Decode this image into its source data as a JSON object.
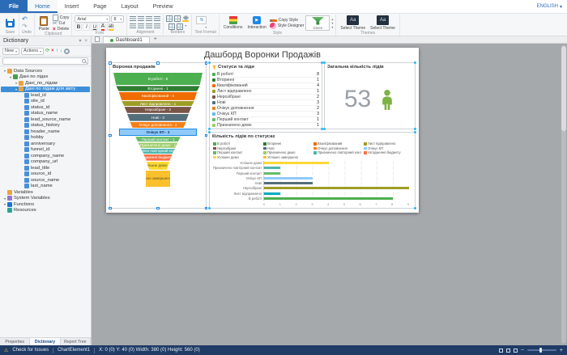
{
  "ribbon": {
    "tabs": [
      "File",
      "Home",
      "Insert",
      "Page",
      "Layout",
      "Preview"
    ],
    "active_tab": "Home",
    "language": "ENGLISH",
    "save": {
      "caption": "Save"
    },
    "undo": {
      "caption": "Undo"
    },
    "clipboard": {
      "caption": "Clipboard",
      "paste": "Paste",
      "copy": "Copy",
      "cut": "Cut",
      "delete": "Delete"
    },
    "font": {
      "caption": "Font",
      "family": "Arial",
      "size": "8",
      "bold": "B",
      "italic": "I",
      "underline": "U"
    },
    "alignment": {
      "caption": "Alignment"
    },
    "borders": {
      "caption": "Borders"
    },
    "text_format": {
      "caption": "Text Format"
    },
    "style": {
      "caption": "Style",
      "conditions": "Conditions",
      "interaction": "Interaction",
      "copy_style": "Copy Style",
      "style_designer": "Style Designer",
      "gallery_selected": "Green"
    },
    "themes": {
      "caption": "Themes",
      "tile1": "Select Theme",
      "tile2": "Select Theme"
    }
  },
  "document_tabs": {
    "tabs": [
      "Dashboard1"
    ],
    "add_label": "+"
  },
  "dictionary": {
    "title": "Dictionary",
    "new_button": "New",
    "actions_button": "Actions",
    "bottom_tabs": [
      "Properties",
      "Dictionary",
      "Report Tree"
    ],
    "active_bottom_tab": "Dictionary",
    "tree": [
      {
        "label": "Data Sources",
        "icon": "datasources",
        "indent": 0,
        "children": true
      },
      {
        "label": "Дані по лідах",
        "icon": "database",
        "indent": 1,
        "children": true
      },
      {
        "label": "Дані_по_лідам",
        "icon": "table",
        "indent": 2,
        "children": true
      },
      {
        "label": "Дані по лідам для звіту",
        "icon": "table",
        "indent": 2,
        "children": true,
        "selected": true
      },
      {
        "label": "lead_id",
        "icon": "field",
        "indent": 3
      },
      {
        "label": "site_id",
        "icon": "field",
        "indent": 3
      },
      {
        "label": "status_id",
        "icon": "field",
        "indent": 3
      },
      {
        "label": "status_name",
        "icon": "field",
        "indent": 3
      },
      {
        "label": "lead_source_name",
        "icon": "field",
        "indent": 3
      },
      {
        "label": "status_history",
        "icon": "field",
        "indent": 3
      },
      {
        "label": "header_name",
        "icon": "field",
        "indent": 3
      },
      {
        "label": "hobby",
        "icon": "field",
        "indent": 3
      },
      {
        "label": "anniversary",
        "icon": "field",
        "indent": 3
      },
      {
        "label": "funnel_id",
        "icon": "field",
        "indent": 3
      },
      {
        "label": "company_name",
        "icon": "field",
        "indent": 3
      },
      {
        "label": "company_url",
        "icon": "field",
        "indent": 3
      },
      {
        "label": "lead_title",
        "icon": "field",
        "indent": 3
      },
      {
        "label": "source_id",
        "icon": "field",
        "indent": 3
      },
      {
        "label": "source_name",
        "icon": "field",
        "indent": 3
      },
      {
        "label": "last_name",
        "icon": "field",
        "indent": 3
      },
      {
        "label": "Variables",
        "icon": "variables",
        "indent": 0
      },
      {
        "label": "System Variables",
        "icon": "system-variables",
        "indent": 0,
        "children": true
      },
      {
        "label": "Functions",
        "icon": "functions",
        "indent": 0,
        "children": true
      },
      {
        "label": "Resources",
        "icon": "resources",
        "indent": 0
      }
    ]
  },
  "dashboard": {
    "title": "Дашборд Воронки Продажів"
  },
  "chart_data": [
    {
      "type": "funnel",
      "title": "Воронка продажів",
      "stages": [
        {
          "label": "В роботі",
          "value": 8,
          "color": "#4caf50"
        },
        {
          "label": "Вторинні",
          "value": 1,
          "color": "#2e7d32"
        },
        {
          "label": "Кваліфікований",
          "value": 4,
          "color": "#ef6c00"
        },
        {
          "label": "Лист відправлено",
          "value": 1,
          "color": "#9e9d24"
        },
        {
          "label": "Нерозібрані",
          "value": 2,
          "color": "#795548"
        },
        {
          "label": "Нові",
          "value": 3,
          "color": "#546e7a"
        },
        {
          "label": "Очікує доповнення",
          "value": 2,
          "color": "#f57f17"
        },
        {
          "label": "Очікує КП",
          "value": 3,
          "color": "#90caf9",
          "selected": true
        },
        {
          "label": "Перший контакт",
          "value": 1,
          "color": "#66bb6a"
        },
        {
          "label": "Призначено демо",
          "value": 1,
          "color": "#9ccc65"
        },
        {
          "label": "Призначено повторний контакт",
          "value": 1,
          "color": "#4db6ac"
        },
        {
          "label": "Узгодження бюджету",
          "value": 2,
          "color": "#ff7043"
        },
        {
          "label": "Успішне демо",
          "value": 4,
          "color": "#fdd835",
          "dark_text": true
        },
        {
          "label": "Успішно завершено",
          "value": 14,
          "color": "#fbc02d",
          "stem": true,
          "dark_text": true
        }
      ]
    },
    {
      "type": "table",
      "title": "Статуси та ліди",
      "rows": [
        {
          "label": "В роботі",
          "value": 8,
          "color": "#4caf50"
        },
        {
          "label": "Вторинні",
          "value": 1,
          "color": "#2e7d32"
        },
        {
          "label": "Кваліфікований",
          "value": 4,
          "color": "#ef6c00"
        },
        {
          "label": "Лист відправлено",
          "value": 1,
          "color": "#9e9d24"
        },
        {
          "label": "Нерозібрані",
          "value": 2,
          "color": "#795548"
        },
        {
          "label": "Нові",
          "value": 3,
          "color": "#546e7a"
        },
        {
          "label": "Очікує доповнення",
          "value": 2,
          "color": "#f57f17"
        },
        {
          "label": "Очікує КП",
          "value": 3,
          "color": "#64b5f6"
        },
        {
          "label": "Перший контакт",
          "value": 1,
          "color": "#66bb6a"
        },
        {
          "label": "Призначено демо",
          "value": 1,
          "color": "#9ccc65"
        }
      ]
    },
    {
      "type": "indicator",
      "title": "Загальна кількість лідів",
      "value": 53
    },
    {
      "type": "bar",
      "title": "Кількість лідів по статусах",
      "orientation": "horizontal",
      "xlim": [
        0,
        9
      ],
      "x_ticks": [
        0,
        1,
        2,
        3,
        4,
        5,
        6,
        7,
        8,
        9
      ],
      "categories": [
        "Успішне демо",
        "Призначено повторний контакт",
        "Перший контакт",
        "Очікує КП",
        "Нові",
        "Нерозібрані",
        "Лист відправлено",
        "В роботі"
      ],
      "values": [
        4,
        1,
        1,
        3,
        3,
        9,
        1,
        8
      ],
      "colors": [
        "#fdd835",
        "#4db6ac",
        "#66bb6a",
        "#90caf9",
        "#546e7a",
        "#9e9d24",
        "#00acc1",
        "#4caf50"
      ],
      "legend_position": "top",
      "legend": [
        {
          "label": "В роботі",
          "color": "#4caf50"
        },
        {
          "label": "Вторинні",
          "color": "#2e7d32"
        },
        {
          "label": "Кваліфікований",
          "color": "#ef6c00"
        },
        {
          "label": "Лист відправлено",
          "color": "#9e9d24"
        },
        {
          "label": "Нерозібрані",
          "color": "#795548"
        },
        {
          "label": "Нові",
          "color": "#546e7a"
        },
        {
          "label": "Очікує доповнення",
          "color": "#f57f17"
        },
        {
          "label": "Очікує КП",
          "color": "#90caf9"
        },
        {
          "label": "Перший контакт",
          "color": "#66bb6a"
        },
        {
          "label": "Призначено демо",
          "color": "#9ccc65"
        },
        {
          "label": "Призначено повторний контакт",
          "color": "#4db6ac"
        },
        {
          "label": "Узгодження бюджету",
          "color": "#ff7043"
        },
        {
          "label": "Успішне демо",
          "color": "#fdd835"
        },
        {
          "label": "Успішно завершено",
          "color": "#fbc02d"
        }
      ]
    }
  ],
  "status_bar": {
    "check_for_issues": "Check for Issues",
    "selected_element": "ChartElement1",
    "position": "X: 0 (0)    Y: 40 (0)    Width: 380 (0)    Height: 560 (0)"
  }
}
